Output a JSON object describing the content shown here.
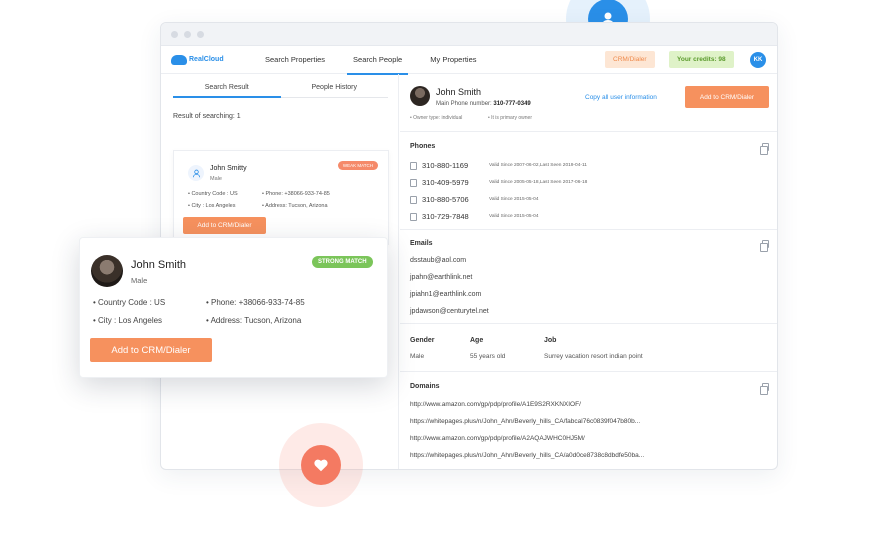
{
  "nav": {
    "logo": "RealCloud",
    "links": [
      "Search Properties",
      "Search People",
      "My Properties"
    ],
    "crm_badge": "CRM/Dialer",
    "credits": "Your credits: 98",
    "user_initials": "KK"
  },
  "left": {
    "tabs": [
      "Search Result",
      "People History"
    ],
    "result_count": "Result of searching: 1",
    "card": {
      "name": "John Smitty",
      "gender": "Male",
      "badge": "WEAK MATCH",
      "country": "• Country Code : US",
      "city": "• City : Los Angeles",
      "phone": "• Phone: +38066-933-74-85",
      "address": "• Address: Tucson, Arizona",
      "button": "Add to CRM/Dialer"
    }
  },
  "profile": {
    "name": "John Smith",
    "phone_label": "Main Phone number:",
    "phone_value": "310-777-0349",
    "owner_type": "• Owner type: individual",
    "primary": "• It is primary owner",
    "copy_link": "Copy all user information",
    "button": "Add to CRM/Dialer"
  },
  "phones": {
    "title": "Phones",
    "items": [
      {
        "number": "310-880-1169",
        "valid": "Valid Since 2007-06-02,Last Seen 2019-04-11"
      },
      {
        "number": "310-409-5979",
        "valid": "Valid Since 2005-05-18,Last Seen 2017-06-18"
      },
      {
        "number": "310-880-5706",
        "valid": "Valid Since 2015-05-04"
      },
      {
        "number": "310-729-7848",
        "valid": "Valid Since 2015-05-04"
      }
    ]
  },
  "emails": {
    "title": "Emails",
    "items": [
      "dsstaub@aol.com",
      "jpahn@earthlink.net",
      "jpiahn1@earthlink.com",
      "jpdawson@centurytel.net"
    ]
  },
  "details": {
    "gender_label": "Gender",
    "gender": "Male",
    "age_label": "Age",
    "age": "55 years old",
    "job_label": "Job",
    "job": "Surrey vacation resort indian point"
  },
  "domains": {
    "title": "Domains",
    "items": [
      "http://www.amazon.com/gp/pdp/profile/A1E9S2RXKNXIOF/",
      "https://whitepages.plus/n/John_Ahn/Beverly_hills_CA/fabcal76c0839f047b80b...",
      "http://www.amazon.com/gp/pdp/profile/A2AQAJWHC0HJ5M/",
      "https://whitepages.plus/n/John_Ahn/Beverly_hills_CA/a0d0ce8738c8dbdfe50ba..."
    ]
  },
  "popup": {
    "name": "John Smith",
    "gender": "Male",
    "badge": "STRONG MATCH",
    "country": "• Country Code : US",
    "city": "• City : Los Angeles",
    "phone": "• Phone: +38066-933-74-85",
    "address": "• Address: Tucson, Arizona",
    "button": "Add to CRM/Dialer"
  },
  "colors": {
    "accent": "#2a8fe8",
    "orange": "#f6915e",
    "green": "#7bc55a",
    "heart": "#f47a62"
  }
}
